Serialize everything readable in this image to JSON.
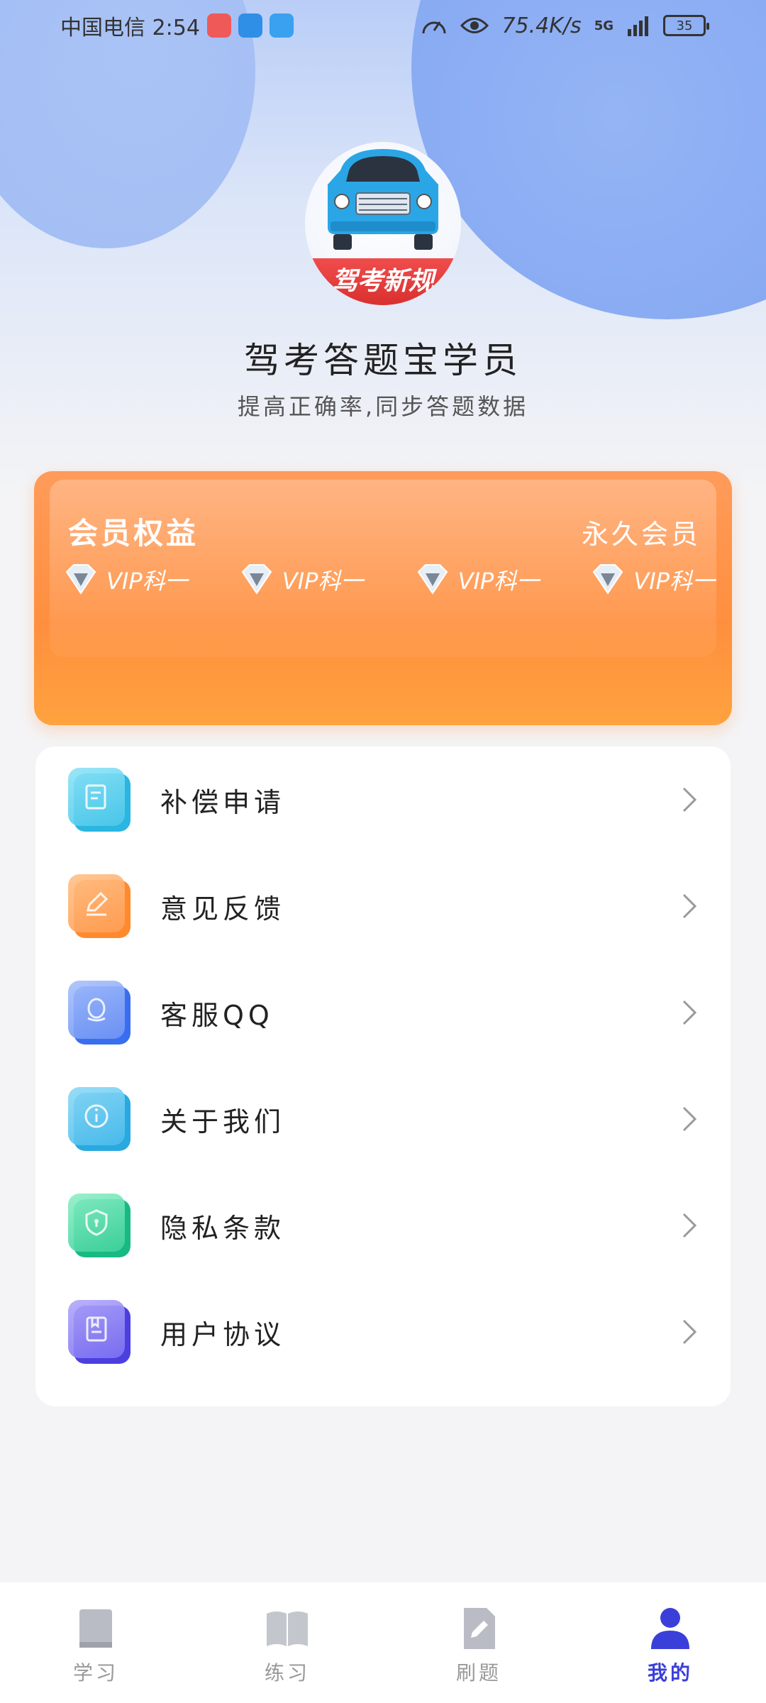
{
  "status_bar": {
    "carrier_time": "中国电信 2:54",
    "net_speed": "75.4K/s",
    "signal": "5G",
    "battery": "35"
  },
  "header": {
    "logo_text": "驾考新规",
    "title": "驾考答题宝学员",
    "subtitle": "提高正确率,同步答题数据"
  },
  "vip": {
    "title": "会员权益",
    "status": "永久会员",
    "items": [
      "VIP科一",
      "VIP科一",
      "VIP科一",
      "VIP科一"
    ]
  },
  "menu": {
    "items": [
      {
        "label": "补偿申请",
        "icon": "document-icon",
        "color": "#3cc7ea"
      },
      {
        "label": "意见反馈",
        "icon": "edit-icon",
        "color": "#ff8c38"
      },
      {
        "label": "客服QQ",
        "icon": "qq-icon",
        "color": "#4a7df2"
      },
      {
        "label": "关于我们",
        "icon": "info-icon",
        "color": "#3bb5e8"
      },
      {
        "label": "隐私条款",
        "icon": "shield-icon",
        "color": "#22c28c"
      },
      {
        "label": "用户协议",
        "icon": "book-icon",
        "color": "#5a4fe0"
      }
    ]
  },
  "bottom_nav": {
    "items": [
      {
        "label": "学习",
        "icon": "book-closed-icon"
      },
      {
        "label": "练习",
        "icon": "book-open-icon"
      },
      {
        "label": "刷题",
        "icon": "note-edit-icon"
      },
      {
        "label": "我的",
        "icon": "user-icon",
        "active": true
      }
    ]
  }
}
